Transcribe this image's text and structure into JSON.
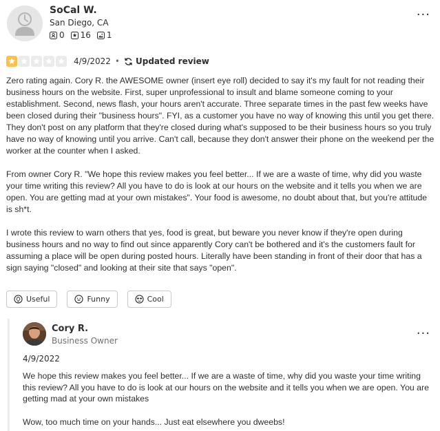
{
  "reviewer": {
    "name": "SoCal W.",
    "location": "San Diego, CA",
    "friends": "0",
    "reviews": "16",
    "photos": "1"
  },
  "review": {
    "rating": 1,
    "max_rating": 5,
    "date": "4/9/2022",
    "separator": "•",
    "updated_label": "Updated review",
    "paragraphs": [
      "Zero rating again. Cory R. the AWESOME owner (insert eye roll) decided to say it's my fault for not reading their business hours on the website. First, super unprofessional to insult and blame someone coming to your establishment. Second, news flash, your hours aren't accurate. Three separate times in the past few weeks have been closed during their \"business hours\". FYI, as a customer you have no way of knowing this until you get there. They don't post on any platform that they're closed during what's supposed to be their business hours so you truly have no way of knowing until you arrive. Can't call, because they don't answer their phone on the weekend per the worker at the counter when I asked.",
      "From owner Cory R. \"We hope this review makes you feel better... If we are a waste of time, why did you waste your time writing this review? All you have to do is look at our hours on the website and it tells you when we are open. You are getting mad at your own mistakes\". Your food is awesome, no doubt about that, but you're attitude is sh*t.",
      "I wrote this review to warn others that yes, food is great, but beware you never know if they're open during business hours and no way to find out since apparently Cory can't be bothered and it's the customers fault for assuming a place will be open during posted hours. Literally have been standing in front of their door that has a sign saying \"closed\" and looking at their site that says \"open\"."
    ],
    "reactions": {
      "useful": "Useful",
      "funny": "Funny",
      "cool": "Cool"
    }
  },
  "owner_reply": {
    "name": "Cory R.",
    "role": "Business Owner",
    "date": "4/9/2022",
    "paragraphs": [
      "We hope this review makes you feel better... If we are a waste of time, why did you waste your time writing this review? All you have to do is look at our hours on the website and it tells you when we are open. You are getting mad at your own mistakes",
      "Wow, too much time on your hands... Just eat elsewhere you dweebs!"
    ]
  },
  "more_menu_label": "...",
  "colors": {
    "star_filled": "#fdc04e",
    "star_empty": "#ebebec",
    "text": "#2d2e2f",
    "muted": "#6e7072",
    "border": "#c8c9ca"
  },
  "icons": {
    "friends": "friends-icon",
    "reviews": "star-badge-icon",
    "photos": "photo-icon",
    "updated": "refresh-icon",
    "useful": "lightbulb-icon",
    "funny": "smile-icon",
    "cool": "sunglasses-icon",
    "more": "more-options-icon"
  }
}
